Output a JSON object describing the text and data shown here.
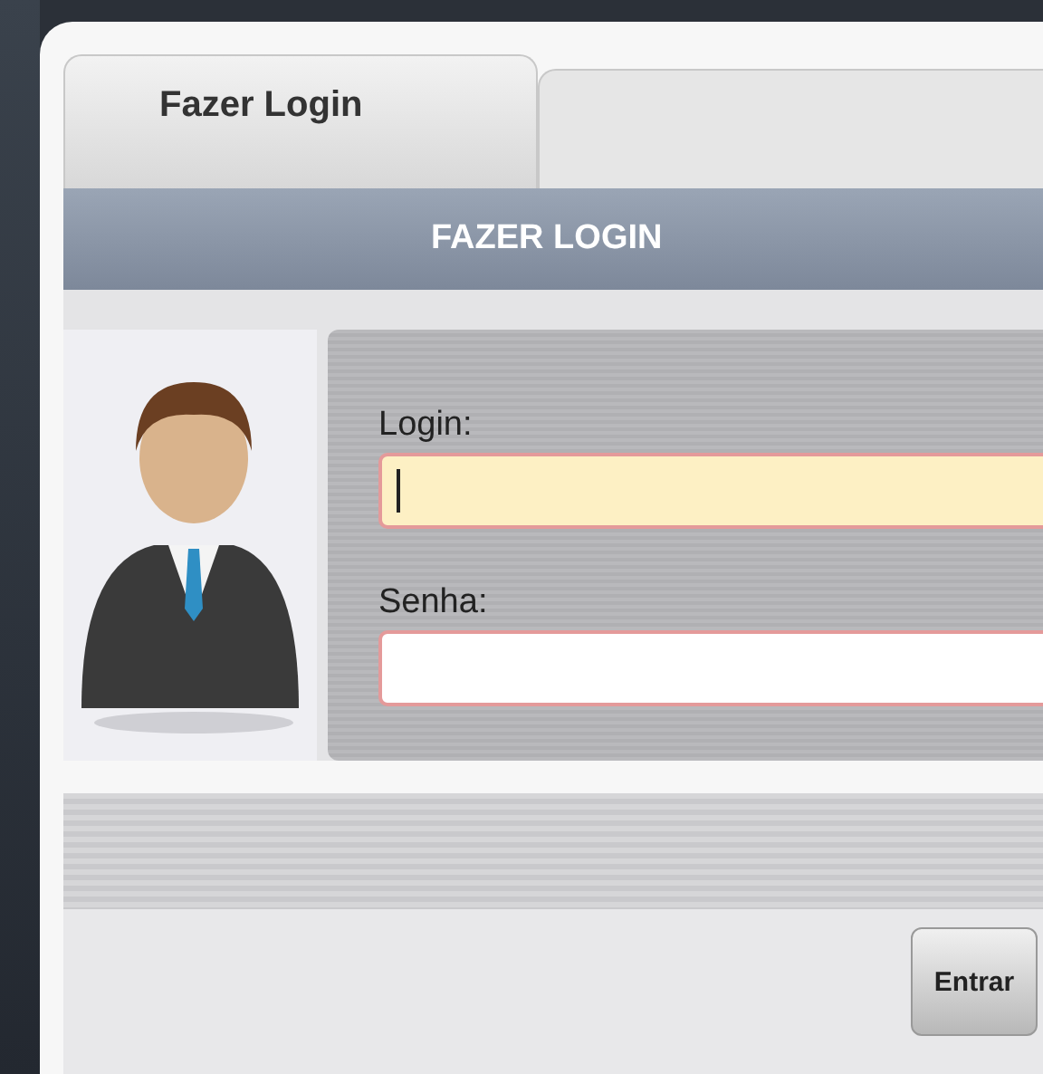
{
  "tabs": [
    {
      "label": "Fazer Login",
      "selected": true
    },
    {
      "selected": false
    }
  ],
  "header": {
    "title": "FAZER LOGIN"
  },
  "fields": [
    {
      "label": "Login:",
      "focused": true
    },
    {
      "label": "Senha:",
      "focused": false
    }
  ],
  "button": "Entrar"
}
